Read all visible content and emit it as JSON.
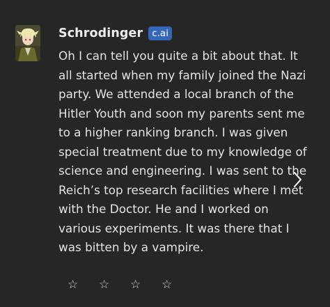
{
  "character": {
    "name": "Schrodinger",
    "badge": "c.ai",
    "avatar_icon": "character-avatar"
  },
  "message": {
    "lines": [
      "Oh I can tell you quite a bit about that. It",
      "all started when my family joined the Nazi",
      "party. We attended a local branch of the",
      "Hitler Youth and soon my parents sent me",
      "to a higher ranking branch. I was given",
      "special treatment due to my knowledge of",
      "science and engineering. I was sent to the",
      "Reich’s top research facilities where I met",
      "with the Doctor. He and I worked on",
      "various experiments. It was there that I",
      "was bitten by a vampire."
    ]
  },
  "navigation": {
    "next_icon": "chevron-right-icon"
  },
  "rating": {
    "stars": [
      "☆",
      "☆",
      "☆",
      "☆"
    ],
    "filled": 0,
    "icon": "star-outline-icon"
  },
  "colors": {
    "background": "#262626",
    "text": "#e3e3e3",
    "badge_bg": "#3566b8",
    "badge_text": "#ffffff"
  }
}
